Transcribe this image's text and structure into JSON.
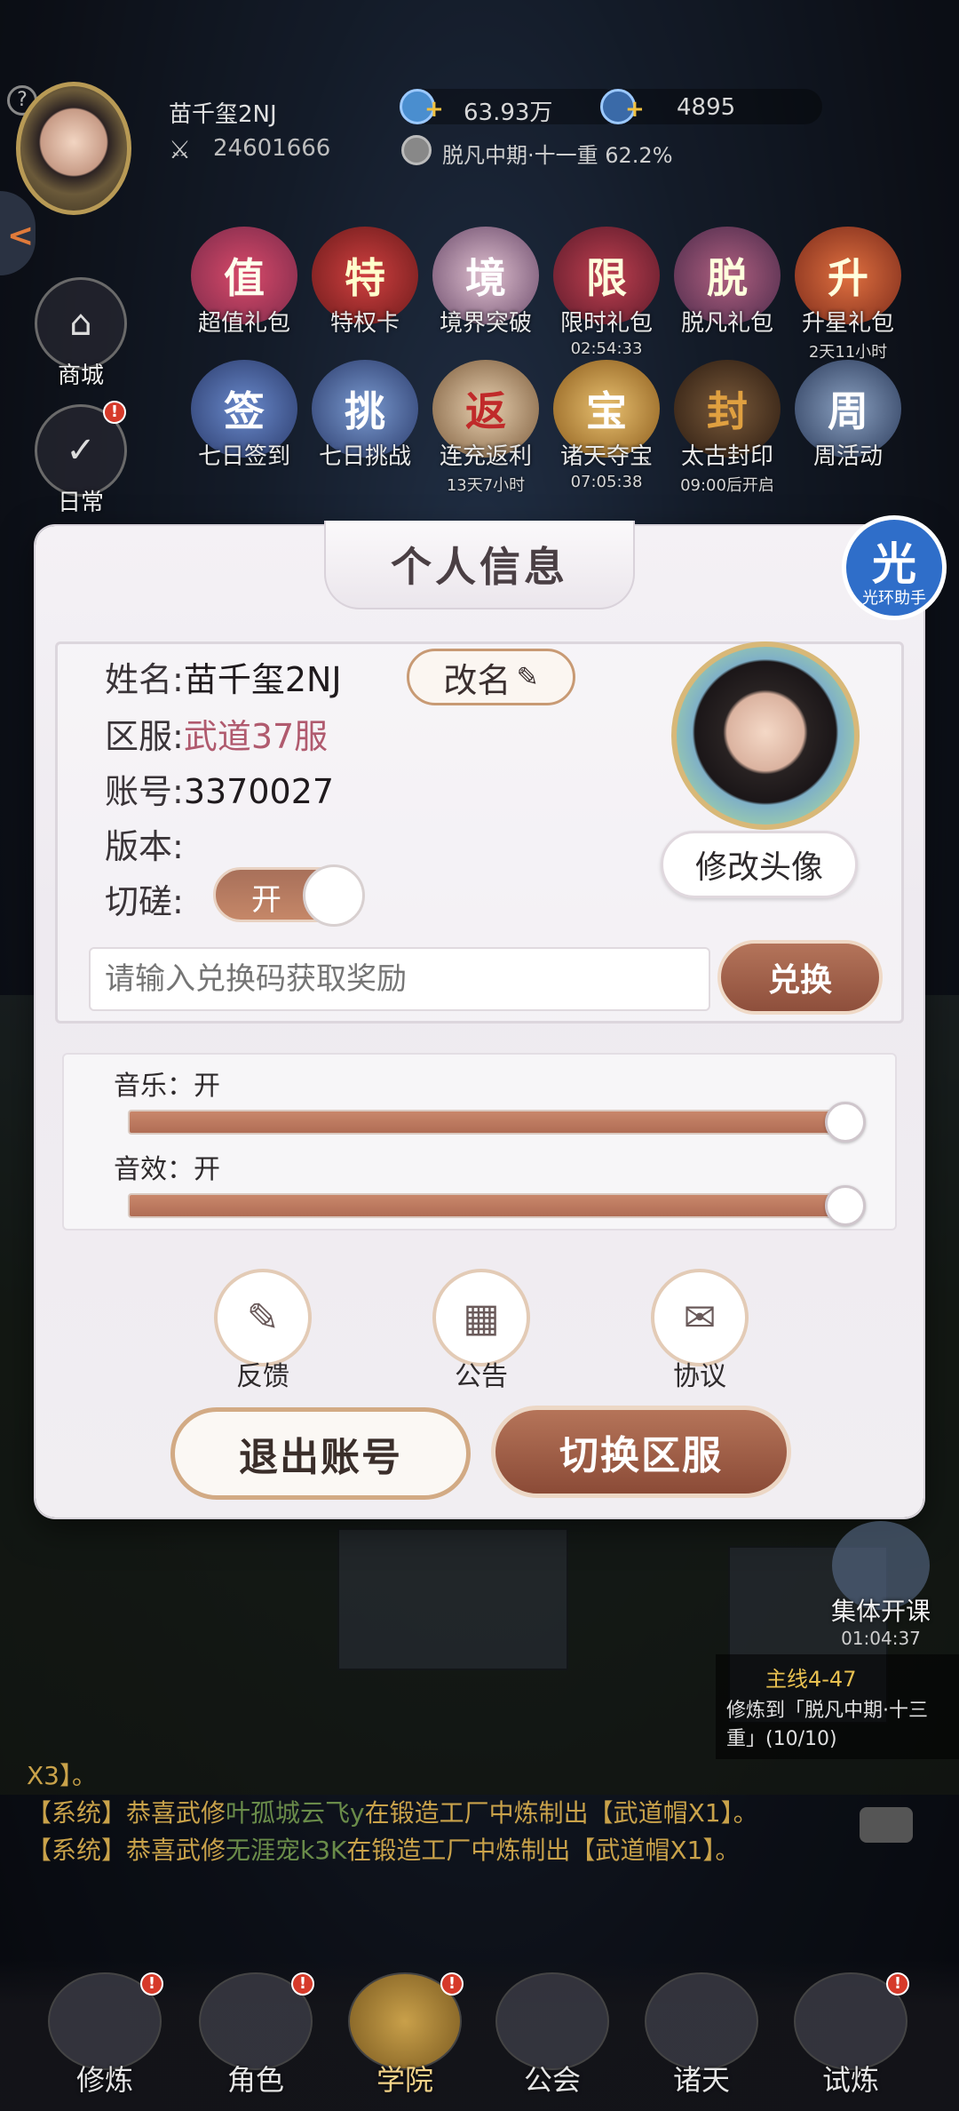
{
  "hud": {
    "player_name": "苗千玺2NJ",
    "power": "24601666",
    "currency_1": "63.93万",
    "currency_2": "4895",
    "realm": "脱凡中期·十一重 62.2%",
    "help": "?"
  },
  "left_menu": [
    {
      "label": "商城",
      "icon": "shop-icon"
    },
    {
      "label": "日常",
      "icon": "daily-icon",
      "badge": "!"
    }
  ],
  "activities": [
    {
      "label": "超值礼包",
      "glyph": "值",
      "timer": ""
    },
    {
      "label": "特权卡",
      "glyph": "特",
      "timer": ""
    },
    {
      "label": "境界突破",
      "glyph": "境",
      "timer": ""
    },
    {
      "label": "限时礼包",
      "glyph": "限",
      "timer": "02:54:33"
    },
    {
      "label": "脱凡礼包",
      "glyph": "脱",
      "timer": ""
    },
    {
      "label": "升星礼包",
      "glyph": "升",
      "timer": "2天11小时"
    },
    {
      "label": "七日签到",
      "glyph": "签",
      "timer": ""
    },
    {
      "label": "七日挑战",
      "glyph": "挑",
      "timer": ""
    },
    {
      "label": "连充返利",
      "glyph": "返",
      "timer": "13天7小时"
    },
    {
      "label": "诸天夺宝",
      "glyph": "宝",
      "timer": "07:05:38"
    },
    {
      "label": "太古封印",
      "glyph": "封",
      "timer": "09:00后开启"
    },
    {
      "label": "周活动",
      "glyph": "周",
      "timer": ""
    }
  ],
  "modal": {
    "title": "个人信息",
    "name_label": "姓名:",
    "name_value": "苗千玺2NJ",
    "rename_label": "改名",
    "server_label": "区服:",
    "server_value": "武道37服",
    "account_label": "账号:",
    "account_value": "3370027",
    "version_label": "版本:",
    "version_value": "",
    "spar_label": "切磋:",
    "spar_toggle": "开",
    "change_avatar": "修改头像",
    "code_placeholder": "请输入兑换码获取奖励",
    "redeem": "兑换",
    "music_label": "音乐：开",
    "music_level": 1.0,
    "sfx_label": "音效：开",
    "sfx_level": 1.0,
    "feedback": "反馈",
    "notice": "公告",
    "agreement": "协议",
    "logout": "退出账号",
    "switch_server": "切换区服"
  },
  "helper": {
    "big": "光",
    "small": "光环助手"
  },
  "class_event": {
    "label": "集体开课",
    "timer": "01:04:37"
  },
  "quest": {
    "title": "主线4-47",
    "text": "修炼到「脱凡中期·十三重」(10/10)"
  },
  "chat": {
    "line0": "X3】。",
    "line1_prefix": "【系统】恭喜武修",
    "line1_name": "叶孤城云飞y",
    "line1_suffix": "在锻造工厂中炼制出【武道帽X1】。",
    "line2_prefix": "【系统】恭喜武修",
    "line2_name": "无涯宠k3K",
    "line2_suffix": "在锻造工厂中炼制出【武道帽X1】。"
  },
  "nav": [
    {
      "label": "修炼",
      "badge": "!"
    },
    {
      "label": "角色",
      "badge": "!"
    },
    {
      "label": "学院",
      "badge": "!",
      "active": true
    },
    {
      "label": "公会",
      "badge": ""
    },
    {
      "label": "诸天",
      "badge": ""
    },
    {
      "label": "试炼",
      "badge": "!"
    }
  ]
}
